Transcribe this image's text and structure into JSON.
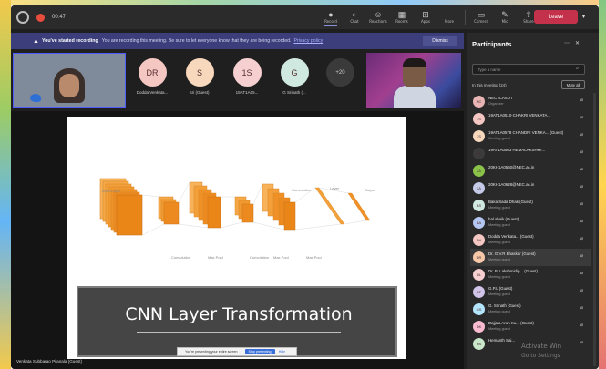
{
  "topbar": {
    "time": "00:47",
    "actions": [
      {
        "glyph": "●",
        "label": "Record",
        "active": true
      },
      {
        "glyph": "◐",
        "label": "Chat"
      },
      {
        "glyph": "☺",
        "label": "Reactions"
      },
      {
        "glyph": "▦",
        "label": "Rooms"
      },
      {
        "glyph": "⊞",
        "label": "Apps"
      },
      {
        "glyph": "⋯",
        "label": "More"
      },
      {
        "glyph": "▭",
        "label": "Camera"
      },
      {
        "glyph": "✎",
        "label": "Mic"
      },
      {
        "glyph": "⇪",
        "label": "Share"
      }
    ],
    "leave_label": "Leave"
  },
  "banner": {
    "bold": "You've started recording",
    "message": "You are recording this meeting. Be sure to let everyone know that they are being recorded.",
    "link": "Privacy policy",
    "dismiss": "Dismiss"
  },
  "gallery": {
    "avatars": [
      {
        "initials": "DR",
        "name": "Dodda Venkata...",
        "color": "#f4c7c3"
      },
      {
        "initials": "S",
        "name": "sri (Guest)",
        "color": "#f7d8bd"
      },
      {
        "initials": "1S",
        "name": "19AT1A05...",
        "color": "#f6cfd0"
      },
      {
        "initials": "G",
        "name": "G Srinath (...",
        "color": "#cfe8e0"
      }
    ],
    "more": "+20"
  },
  "slide": {
    "title": "CNN Layer Transformation",
    "captions": [
      "Input Layer",
      "Convolution",
      "Max Pool",
      "Convolution",
      "Max Pool",
      "Convolution",
      "Max Pool",
      "Layer",
      "Output"
    ],
    "share_text": "You're presenting your entire screen",
    "stop_label": "Stop presenting",
    "hide_label": "Hide"
  },
  "presenter": "Venkata Subbarao Pilanala (Guest)",
  "watermark": {
    "line1": "Activate Win",
    "line2": "Go to Settings"
  },
  "panel": {
    "title": "Participants",
    "search_placeholder": "Type a name",
    "section": "In this meeting (24)",
    "mute_all": "Mute all",
    "participants": [
      {
        "initials": "NC",
        "name": "NEC ICASDT",
        "role": "Organizer",
        "color": "#e8b4b4"
      },
      {
        "initials": "1S",
        "name": "19AT1A0510-CHAKRI VENKATA...",
        "role": "",
        "color": "#f4c7c3"
      },
      {
        "initials": "1S",
        "name": "19AT1A0578 CHANDRI VENKA... (Guest)",
        "role": "Meeting guest",
        "color": "#f7d8bd"
      },
      {
        "initials": "1S",
        "name": "19AT1A0563 HEMALAKSHMI...",
        "role": "",
        "color": "#3b3b3b"
      },
      {
        "initials": "2A",
        "name": "20KH1A0560@NEC.ac.in",
        "role": "",
        "color": "#8bc34a"
      },
      {
        "initials": "2A",
        "name": "20KH1A0628@NEC.ac.in",
        "role": "",
        "color": "#c5cae9"
      },
      {
        "initials": "BS",
        "name": "Baka Sada Dhak (Guest)",
        "role": "Meeting guest",
        "color": "#cfe8e0"
      },
      {
        "initials": "BA",
        "name": "bal shaik (Guest)",
        "role": "Meeting guest",
        "color": "#b3c7f2"
      },
      {
        "initials": "DV",
        "name": "Dodda Venkata... (Guest)",
        "role": "Meeting guest",
        "color": "#f4c7c3"
      },
      {
        "initials": "DR",
        "name": "Dr. G.V.R Bhaskar (Guest)",
        "role": "Meeting guest",
        "color": "#f7c9a8",
        "highlight": true
      },
      {
        "initials": "DL",
        "name": "Dr. B. Lakshmidip... (Guest)",
        "role": "Meeting guest",
        "color": "#f6cfd0"
      },
      {
        "initials": "GP",
        "name": "G.P.L (Guest)",
        "role": "Meeting guest",
        "color": "#d1c4e9"
      },
      {
        "initials": "GS",
        "name": "G. Srinath (Guest)",
        "role": "Meeting guest",
        "color": "#b3e5fc"
      },
      {
        "initials": "DK",
        "name": "Dajjala Arun Ku... (Guest)",
        "role": "Meeting guest",
        "color": "#f8bbd0"
      },
      {
        "initials": "HS",
        "name": "Hemanth Sai...",
        "role": "",
        "color": "#c8e6c9"
      }
    ]
  }
}
